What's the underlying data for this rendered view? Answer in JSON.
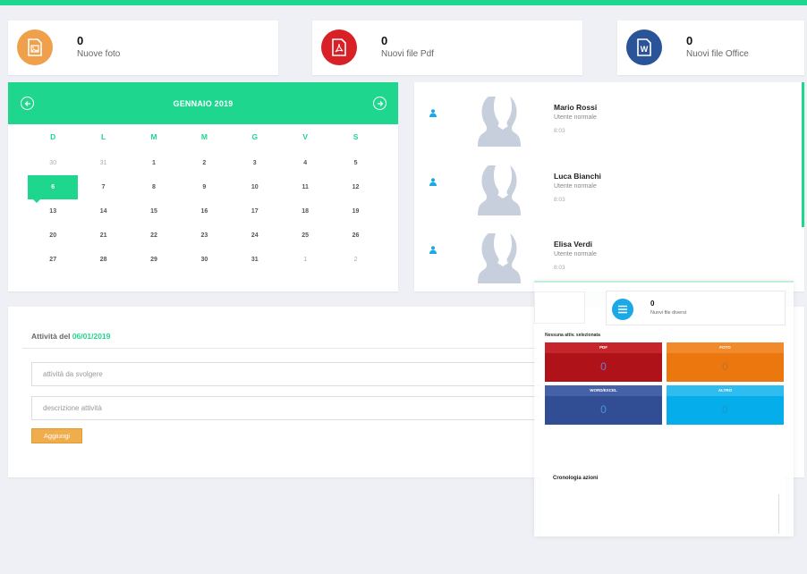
{
  "colors": {
    "accent": "#1ed68d",
    "photo": "#f0a04b",
    "pdf": "#d92027",
    "office": "#2b5397",
    "misc": "#1aa9e6",
    "button": "#f0ad4e"
  },
  "stats": [
    {
      "count": "0",
      "label": "Nuove foto",
      "icon": "image-icon"
    },
    {
      "count": "0",
      "label": "Nuovi file Pdf",
      "icon": "pdf-icon"
    },
    {
      "count": "0",
      "label": "Nuovi file Office",
      "icon": "word-icon"
    }
  ],
  "calendar": {
    "month_label": "GENNAIO 2019",
    "weekdays": [
      "D",
      "L",
      "M",
      "M",
      "G",
      "V",
      "S"
    ],
    "weeks": [
      [
        "30",
        "31",
        "1",
        "2",
        "3",
        "4",
        "5"
      ],
      [
        "6",
        "7",
        "8",
        "9",
        "10",
        "11",
        "12"
      ],
      [
        "13",
        "14",
        "15",
        "16",
        "17",
        "18",
        "19"
      ],
      [
        "20",
        "21",
        "22",
        "23",
        "24",
        "25",
        "26"
      ],
      [
        "27",
        "28",
        "29",
        "30",
        "31",
        "1",
        "2"
      ]
    ],
    "today": "6"
  },
  "users": [
    {
      "name": "Mario Rossi",
      "role": "Utente normale",
      "time": "8:03"
    },
    {
      "name": "Luca Bianchi",
      "role": "Utente normale",
      "time": "8:03"
    },
    {
      "name": "Elisa Verdi",
      "role": "Utente normale",
      "time": "8:03"
    }
  ],
  "activities": {
    "title_prefix": "Attività del",
    "date": "06/01/2019",
    "task_placeholder": "attività da svolgere",
    "desc_placeholder": "descrizione attività",
    "add_label": "Aggiungi"
  },
  "overlay": {
    "stat_count": "0",
    "stat_label": "Nuovi file diversi",
    "none_selected": "Nessuna attiv. selezionata",
    "tiles": [
      {
        "label": "PDF",
        "count": "0"
      },
      {
        "label": "FOTO",
        "count": "0"
      },
      {
        "label": "WORD/EXCEL",
        "count": "0"
      },
      {
        "label": "ALTRO",
        "count": "0"
      }
    ],
    "history_title": "Cronologia azioni"
  }
}
